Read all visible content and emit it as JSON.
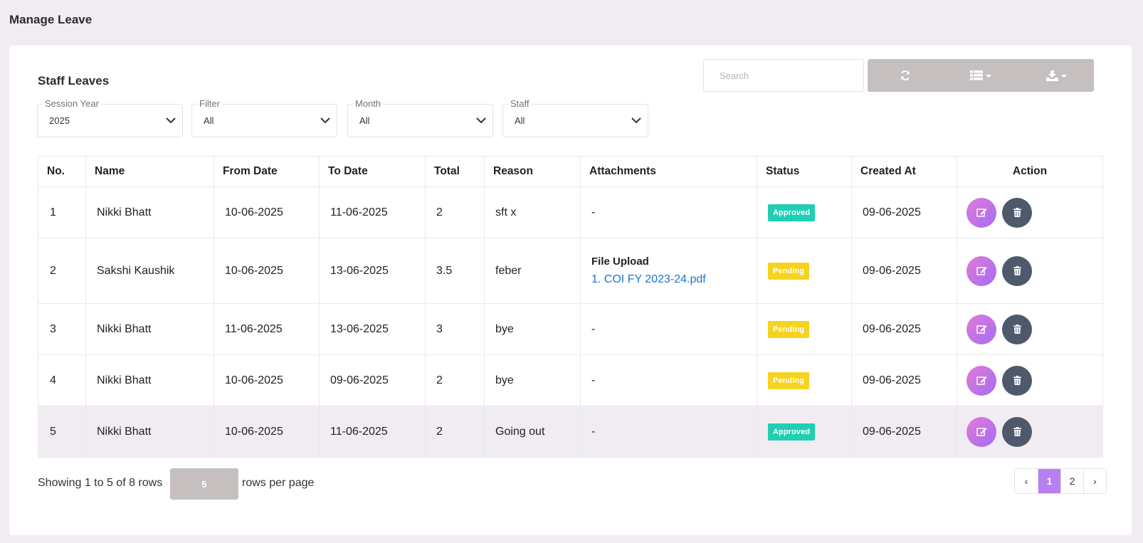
{
  "page": {
    "title": "Manage Leave"
  },
  "card": {
    "title": "Staff Leaves"
  },
  "filters": [
    {
      "label": "Session Year",
      "value": "2025"
    },
    {
      "label": "Filter",
      "value": "All"
    },
    {
      "label": "Month",
      "value": "All"
    },
    {
      "label": "Staff",
      "value": "All"
    }
  ],
  "search": {
    "placeholder": "Search",
    "value": ""
  },
  "toolbar": {
    "icons": [
      "refresh-icon",
      "columns-icon",
      "export-icon"
    ]
  },
  "table": {
    "headers": [
      "No.",
      "Name",
      "From Date",
      "To Date",
      "Total",
      "Reason",
      "Attachments",
      "Status",
      "Created At",
      "Action"
    ],
    "rows": [
      {
        "no": "1",
        "name": "Nikki Bhatt",
        "from": "10-06-2025",
        "to": "11-06-2025",
        "total": "2",
        "reason": "sft x",
        "attachment": "-",
        "status": "Approved",
        "created": "09-06-2025"
      },
      {
        "no": "2",
        "name": "Sakshi Kaushik",
        "from": "10-06-2025",
        "to": "13-06-2025",
        "total": "3.5",
        "reason": "feber",
        "attachment_title": "File Upload",
        "attachment_link": "1. COI FY 2023-24.pdf",
        "status": "Pending",
        "created": "09-06-2025"
      },
      {
        "no": "3",
        "name": "Nikki Bhatt",
        "from": "11-06-2025",
        "to": "13-06-2025",
        "total": "3",
        "reason": "bye",
        "attachment": "-",
        "status": "Pending",
        "created": "09-06-2025"
      },
      {
        "no": "4",
        "name": "Nikki Bhatt",
        "from": "10-06-2025",
        "to": "09-06-2025",
        "total": "2",
        "reason": "bye",
        "attachment": "-",
        "status": "Pending",
        "created": "09-06-2025"
      },
      {
        "no": "5",
        "name": "Nikki Bhatt",
        "from": "10-06-2025",
        "to": "11-06-2025",
        "total": "2",
        "reason": "Going out",
        "attachment": "-",
        "status": "Approved",
        "created": "09-06-2025"
      }
    ]
  },
  "pagination": {
    "showing": "Showing 1 to 5 of 8 rows",
    "rows_per_page": "5",
    "rows_per_page_label": "rows per page",
    "prev": "‹",
    "pages": [
      "1",
      "2"
    ],
    "next": "›"
  },
  "colors": {
    "approved": "#1fcfb3",
    "pending": "#f6d31f",
    "accent": "#b77ff2",
    "delete": "#4e596b"
  }
}
